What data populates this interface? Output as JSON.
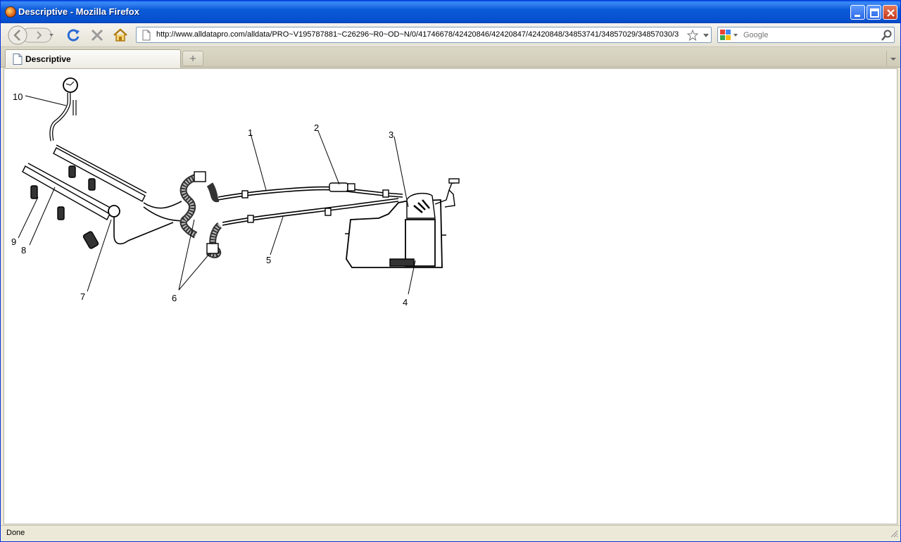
{
  "window": {
    "title": "Descriptive - Mozilla Firefox"
  },
  "navbar": {
    "url": "http://www.alldatapro.com/alldata/PRO~V195787881~C26296~R0~OD~N/0/41746678/42420846/42420847/42420848/34853741/34857029/34857030/3",
    "search_placeholder": "Google"
  },
  "tabs": [
    {
      "label": "Descriptive"
    }
  ],
  "diagram": {
    "callouts": [
      "1",
      "2",
      "3",
      "4",
      "5",
      "6",
      "7",
      "8",
      "9",
      "10"
    ]
  },
  "status": {
    "text": "Done"
  },
  "colors": {
    "titlebar": "#0650d0",
    "chrome": "#ece9d8",
    "close_button": "#c6381c"
  }
}
